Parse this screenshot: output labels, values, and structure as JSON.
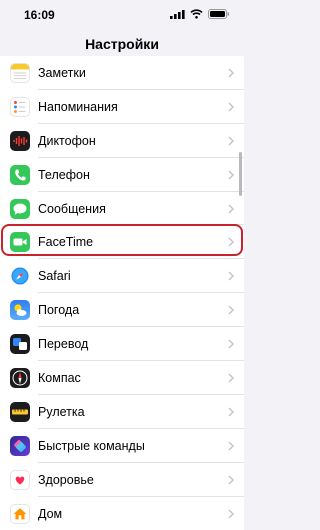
{
  "status": {
    "time": "16:09"
  },
  "header": {
    "title": "Настройки"
  },
  "items": [
    {
      "label": "Заметки",
      "icon": "notes-icon"
    },
    {
      "label": "Напоминания",
      "icon": "reminders-icon"
    },
    {
      "label": "Диктофон",
      "icon": "voice-memos-icon"
    },
    {
      "label": "Телефон",
      "icon": "phone-icon"
    },
    {
      "label": "Сообщения",
      "icon": "messages-icon"
    },
    {
      "label": "FaceTime",
      "icon": "facetime-icon"
    },
    {
      "label": "Safari",
      "icon": "safari-icon"
    },
    {
      "label": "Погода",
      "icon": "weather-icon"
    },
    {
      "label": "Перевод",
      "icon": "translate-icon"
    },
    {
      "label": "Компас",
      "icon": "compass-icon"
    },
    {
      "label": "Рулетка",
      "icon": "measure-icon"
    },
    {
      "label": "Быстрые команды",
      "icon": "shortcuts-icon"
    },
    {
      "label": "Здоровье",
      "icon": "health-icon"
    },
    {
      "label": "Дом",
      "icon": "home-icon"
    }
  ],
  "colors": {
    "accent_highlight": "#c8232c",
    "background": "#f2f2f7"
  }
}
